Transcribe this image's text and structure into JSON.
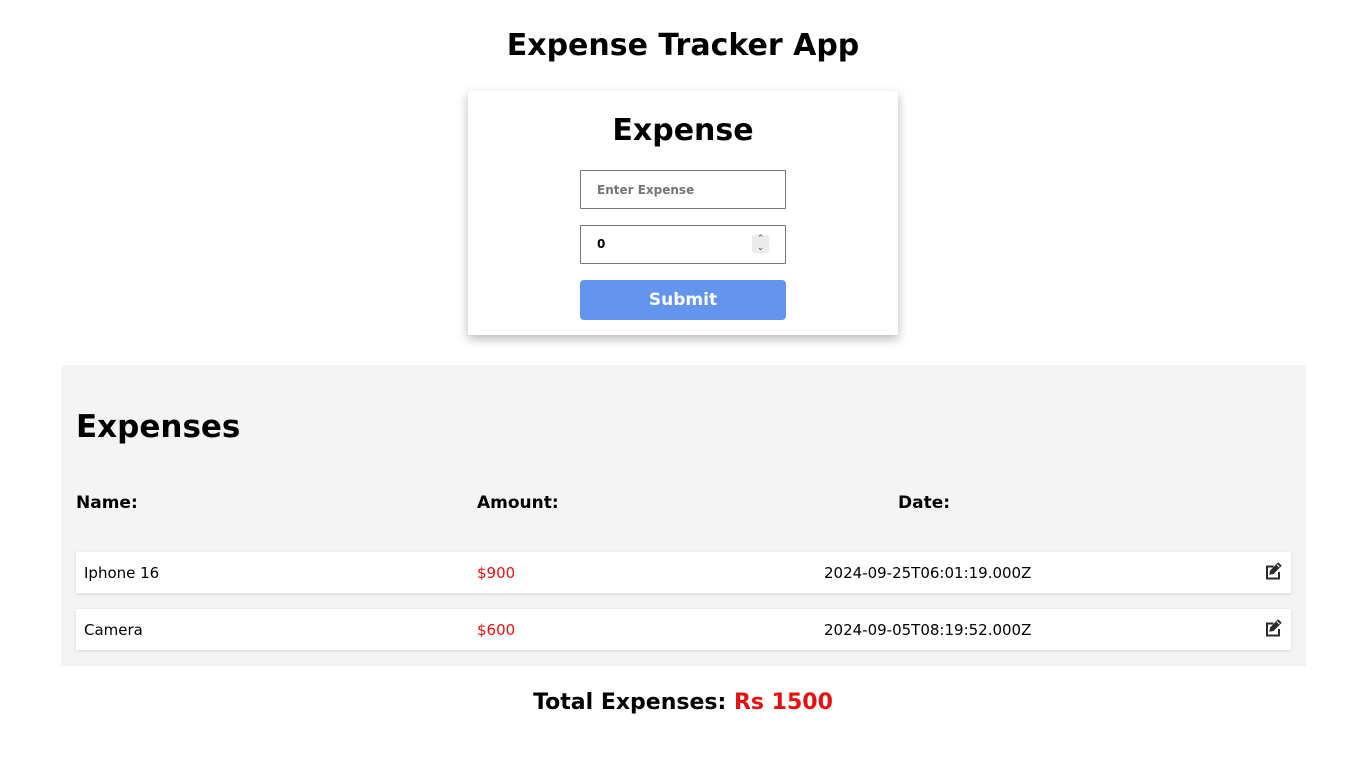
{
  "app": {
    "title": "Expense Tracker App"
  },
  "form": {
    "title": "Expense",
    "name_placeholder": "Enter Expense",
    "name_value": "",
    "amount_value": "0",
    "submit_label": "Submit"
  },
  "expenses": {
    "title": "Expenses",
    "headers": {
      "name": "Name:",
      "amount": "Amount:",
      "date": "Date:"
    },
    "rows": [
      {
        "name": "Iphone 16",
        "amount": "$900",
        "date": "2024-09-25T06:01:19.000Z",
        "icon": "edit-icon"
      },
      {
        "name": "Camera",
        "amount": "$600",
        "date": "2024-09-05T08:19:52.000Z",
        "icon": "edit-icon"
      }
    ]
  },
  "total": {
    "label": "Total Expenses: ",
    "value": "Rs 1500"
  },
  "colors": {
    "accent": "#6495ed",
    "amount": "#e51111",
    "panel": "#f4f4f4"
  }
}
